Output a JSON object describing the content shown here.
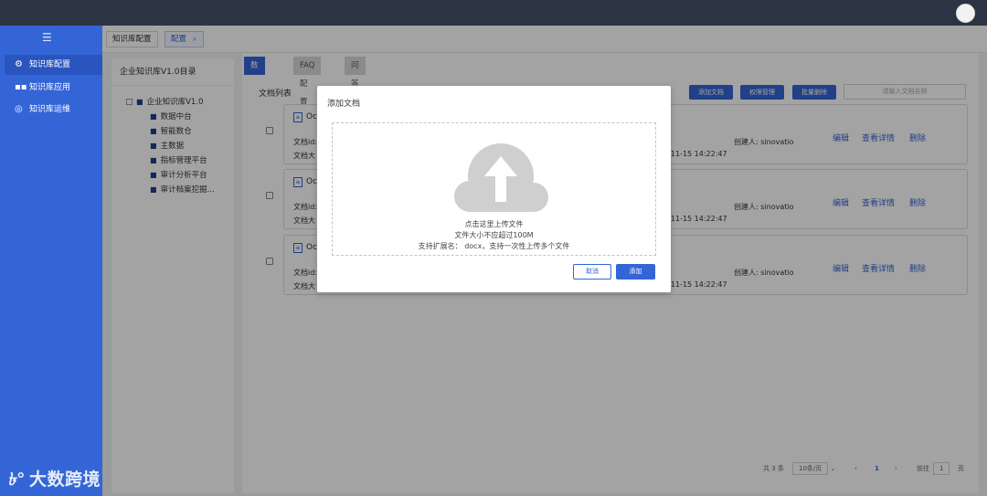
{
  "sidebar": {
    "items": [
      {
        "label": "知识库配置",
        "icon": "gear-icon"
      },
      {
        "label": "知识库应用",
        "icon": "apps-icon"
      },
      {
        "label": "知识库运维",
        "icon": "maintenance-icon"
      }
    ],
    "brand": "大数跨境"
  },
  "tabs": [
    {
      "label": "知识库配置"
    },
    {
      "label": "配置",
      "close": "×"
    }
  ],
  "tree": {
    "header": "企业知识库V1.0目录",
    "root": "企业知识库V1.0",
    "children": [
      "数据中台",
      "智能数仓",
      "主数据",
      "指标管理平台",
      "审计分析平台",
      "审计档案挖掘..."
    ]
  },
  "subtabs": [
    "数据配置",
    "FAQ配置",
    "问答测试"
  ],
  "list": {
    "title": "文档列表",
    "buttons": [
      "添加文档",
      "权限管理",
      "批量删除"
    ],
    "search_placeholder": "请输入文档名称",
    "cards": [
      {
        "name": "Oc",
        "id_label": "文档id:",
        "size_label": "文档大",
        "date": "-11-15 14:22:47",
        "creator": "创建人: sinovatio"
      },
      {
        "name": "Oc",
        "id_label": "文档id:",
        "size_label": "文档大",
        "date": "-11-15 14:22:47",
        "creator": "创建人: sinovatio"
      },
      {
        "name": "Oc",
        "id_label": "文档id:",
        "size_label": "文档大",
        "date": "-11-15 14:22:47",
        "creator": "创建人: sinovatio"
      }
    ],
    "actions": [
      "编辑",
      "查看详情",
      "删除"
    ]
  },
  "pager": {
    "total": "共 3 条",
    "page_size": "10条/页",
    "prev": "‹",
    "current": "1",
    "next": "›",
    "goto_label": "前往",
    "goto_value": "1",
    "page_suffix": "页"
  },
  "modal": {
    "title": "添加文档",
    "hint1": "点击这里上传文件",
    "hint2": "文件大小不应超过100M",
    "hint3": "支持扩展名： docx，支持一次性上传多个文件",
    "cancel": "取消",
    "ok": "添加"
  },
  "colors": {
    "accent": "#3465d6",
    "topbar": "#2c3443",
    "cloud": "#cfcfcf"
  }
}
